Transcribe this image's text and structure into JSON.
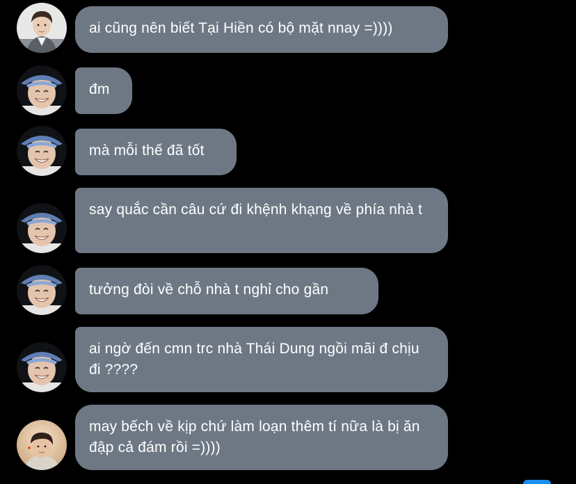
{
  "conversation": {
    "messages": [
      {
        "text": "ai cũng nên biết Tại Hiền có bộ mặt nnay =))))",
        "avatar": "avatar-boy-gray-shirt"
      },
      {
        "text": "đm",
        "avatar": "avatar-bucket-hat-smile"
      },
      {
        "text": "mà mỗi thế đã tốt",
        "avatar": "avatar-bucket-hat-smile"
      },
      {
        "text": "say quắc cần câu cứ đi khệnh khạng về phía nhà t",
        "avatar": "avatar-bucket-hat-smile"
      },
      {
        "text": "tưởng đòi về chỗ nhà t nghỉ cho gần",
        "avatar": "avatar-bucket-hat-smile"
      },
      {
        "text": "ai ngờ đến cmn trc nhà Thái Dung ngồi mãi đ chịu đi ????",
        "avatar": "avatar-bucket-hat-smile"
      },
      {
        "text": "may bếch về kịp chứ làm loạn thêm tí nữa là bị ăn đập cả đám rồi =))))",
        "avatar": "avatar-boy-warm-light"
      }
    ]
  },
  "colors": {
    "background": "#000000",
    "bubble": "#6e7885",
    "bubble_text": "#ffffff",
    "accent": "#1b8ef2"
  }
}
